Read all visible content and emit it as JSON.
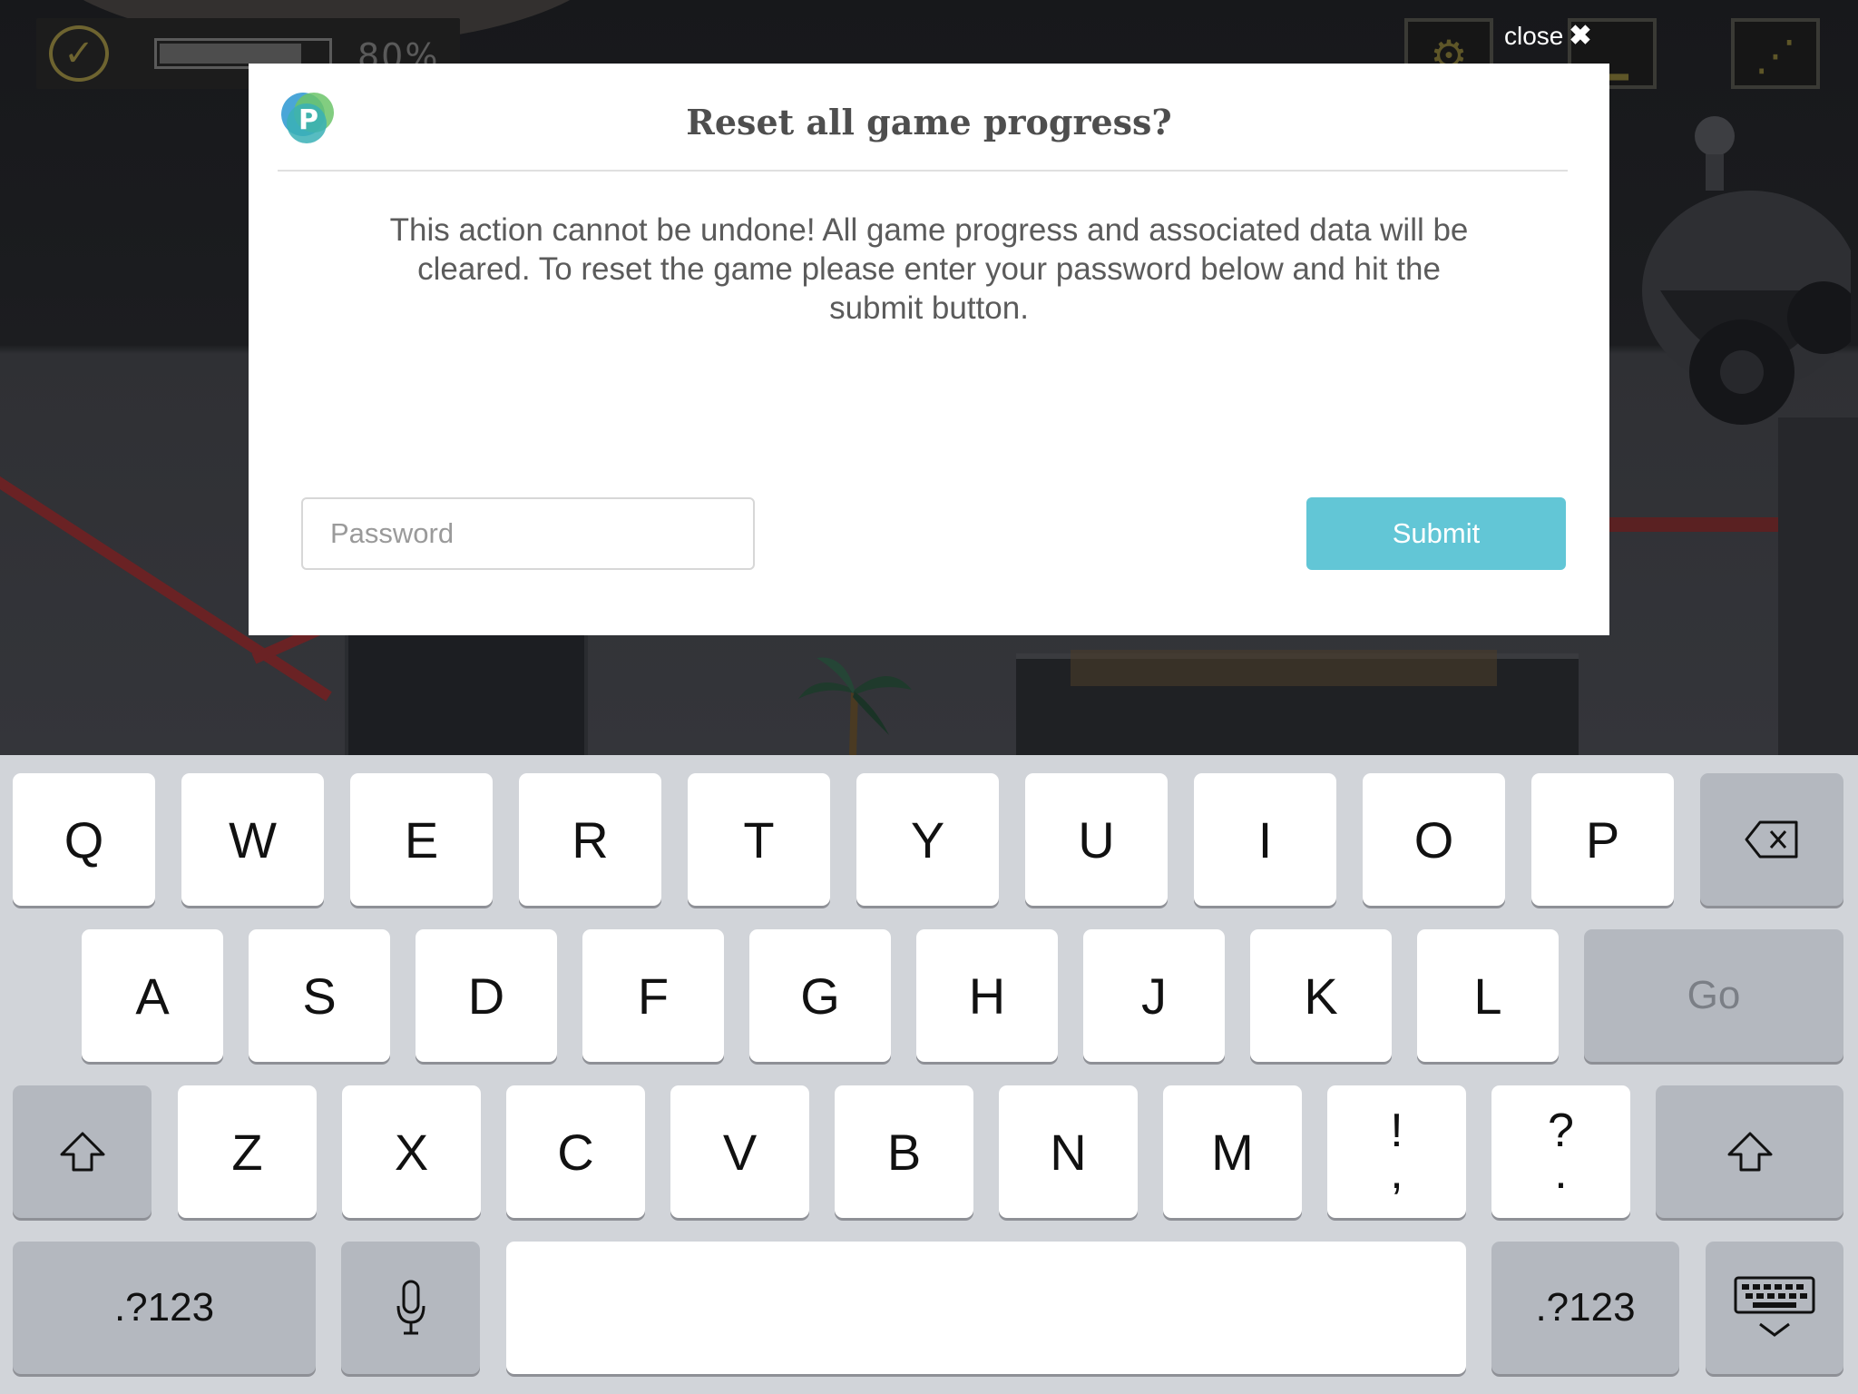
{
  "hud": {
    "progress_level": 0.85,
    "percent_text": "80%"
  },
  "close": {
    "label": "close",
    "icon": "close-x-icon"
  },
  "modal": {
    "title": "Reset all game progress?",
    "body": "This action cannot be undone! All game progress and associated data will be cleared. To reset the game please enter your password below and hit the submit button.",
    "password_placeholder": "Password",
    "password_value": "",
    "submit_label": "Submit",
    "logo_letter": "P"
  },
  "keyboard": {
    "row1": [
      "Q",
      "W",
      "E",
      "R",
      "T",
      "Y",
      "U",
      "I",
      "O",
      "P"
    ],
    "row2": [
      "A",
      "S",
      "D",
      "F",
      "G",
      "H",
      "J",
      "K",
      "L"
    ],
    "row3": [
      "Z",
      "X",
      "C",
      "V",
      "B",
      "N",
      "M"
    ],
    "punct1": {
      "top": "!",
      "bottom": ","
    },
    "punct2": {
      "top": "?",
      "bottom": "."
    },
    "go_label": "Go",
    "numbers_label": ".?123",
    "icons": {
      "delete": "backspace-icon",
      "shift": "shift-icon",
      "mic": "microphone-icon",
      "dismiss": "keyboard-dismiss-icon"
    }
  },
  "colors": {
    "submit": "#62c6d6",
    "keyboard_bg": "#d1d4d9",
    "key_gray": "#b4b8bf"
  }
}
